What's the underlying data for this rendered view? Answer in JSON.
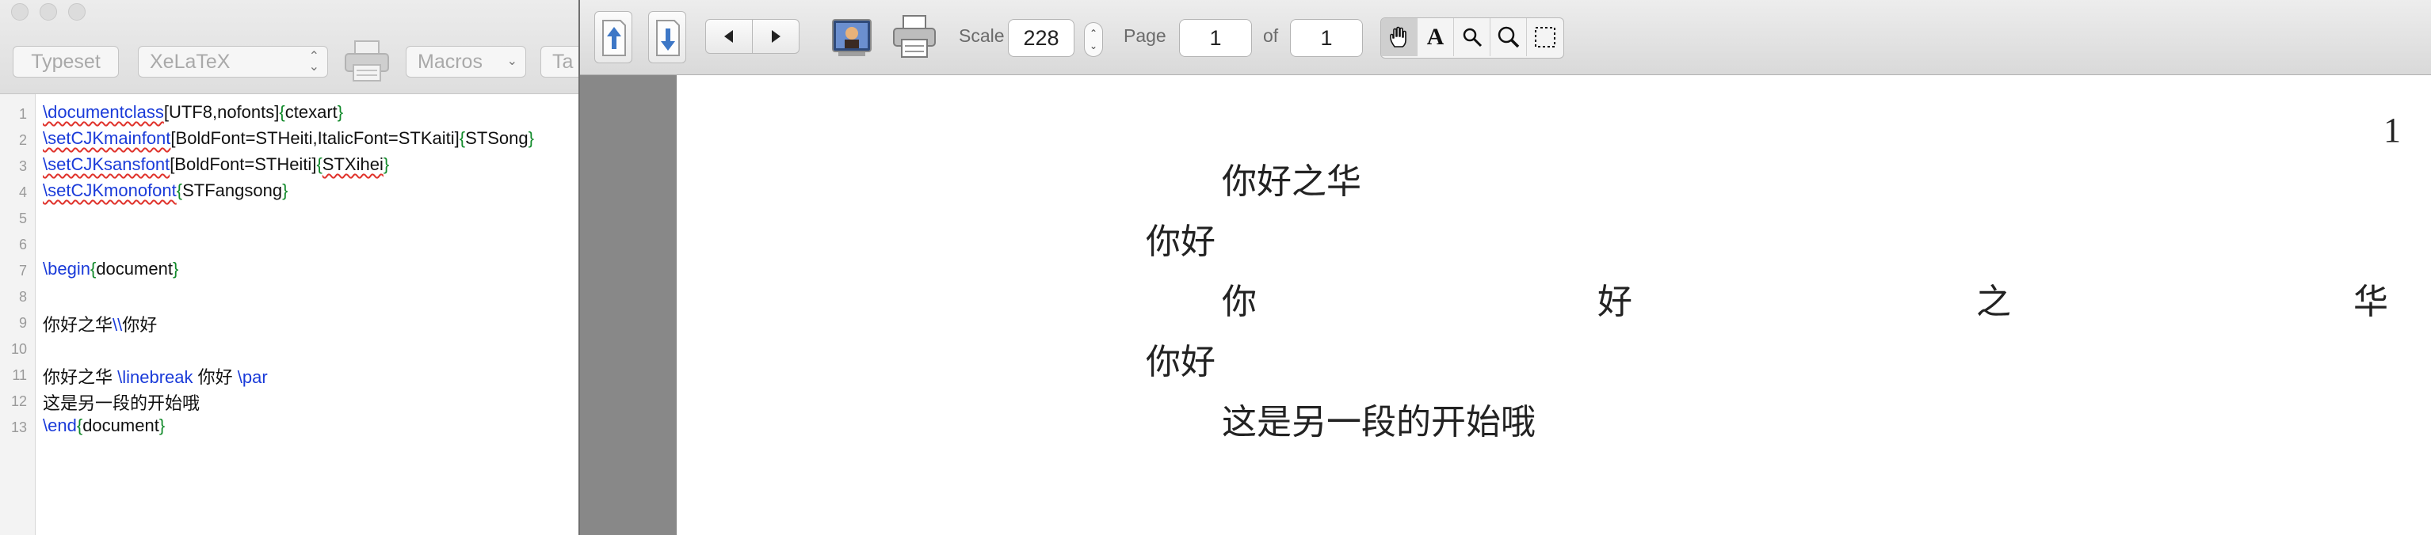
{
  "editor": {
    "toolbar": {
      "typeset_label": "Typeset",
      "engine_value": "XeLaTeX",
      "macros_label": "Macros",
      "tags_label": "Ta"
    },
    "line_numbers": [
      "1",
      "2",
      "3",
      "4",
      "5",
      "6",
      "7",
      "8",
      "9",
      "10",
      "11",
      "12",
      "13"
    ],
    "code": {
      "l1": {
        "cmd": "\\documentclass",
        "opt": "[UTF8,nofonts]",
        "ob": "{",
        "arg": "ctexart",
        "cb": "}"
      },
      "l2": {
        "cmd": "\\setCJKmainfont",
        "opt": "[BoldFont=STHeiti,ItalicFont=STKaiti]",
        "ob": "{",
        "arg": "STSong",
        "cb": "}"
      },
      "l3": {
        "cmd": "\\setCJKsansfont",
        "opt": "[BoldFont=STHeiti]",
        "ob": "{",
        "arg": "STXihei",
        "cb": "}"
      },
      "l4": {
        "cmd": "\\setCJKmonofont",
        "ob": "{",
        "arg": "STFangsong",
        "cb": "}"
      },
      "l7": {
        "cmd": "\\begin",
        "ob": "{",
        "arg": "document",
        "cb": "}"
      },
      "l9": {
        "a": "你好之华",
        "cmd": "\\\\",
        "b": "你好"
      },
      "l11": {
        "a": "你好之华 ",
        "cmd1": "\\linebreak",
        "b": " 你好 ",
        "cmd2": "\\par"
      },
      "l12": {
        "a": "这是另一段的开始哦"
      },
      "l13": {
        "cmd": "\\end",
        "ob": "{",
        "arg": "document",
        "cb": "}"
      }
    }
  },
  "viewer": {
    "toolbar": {
      "scale_label": "Scale",
      "scale_value": "228",
      "page_label": "Page",
      "page_value": "1",
      "of_label": "of",
      "page_total": "1",
      "text_tool_glyph": "A"
    },
    "pdf": {
      "page_number": "1",
      "lines": {
        "l1": "你好之华",
        "l2": "你好",
        "l3_chars": [
          "你",
          "好",
          "之",
          "华"
        ],
        "l4": "你好",
        "l5": "这是另一段的开始哦"
      }
    }
  },
  "colors": {
    "command": "#1a3bd9",
    "group": "#118a2a",
    "spell_underline": "#e0332c"
  }
}
